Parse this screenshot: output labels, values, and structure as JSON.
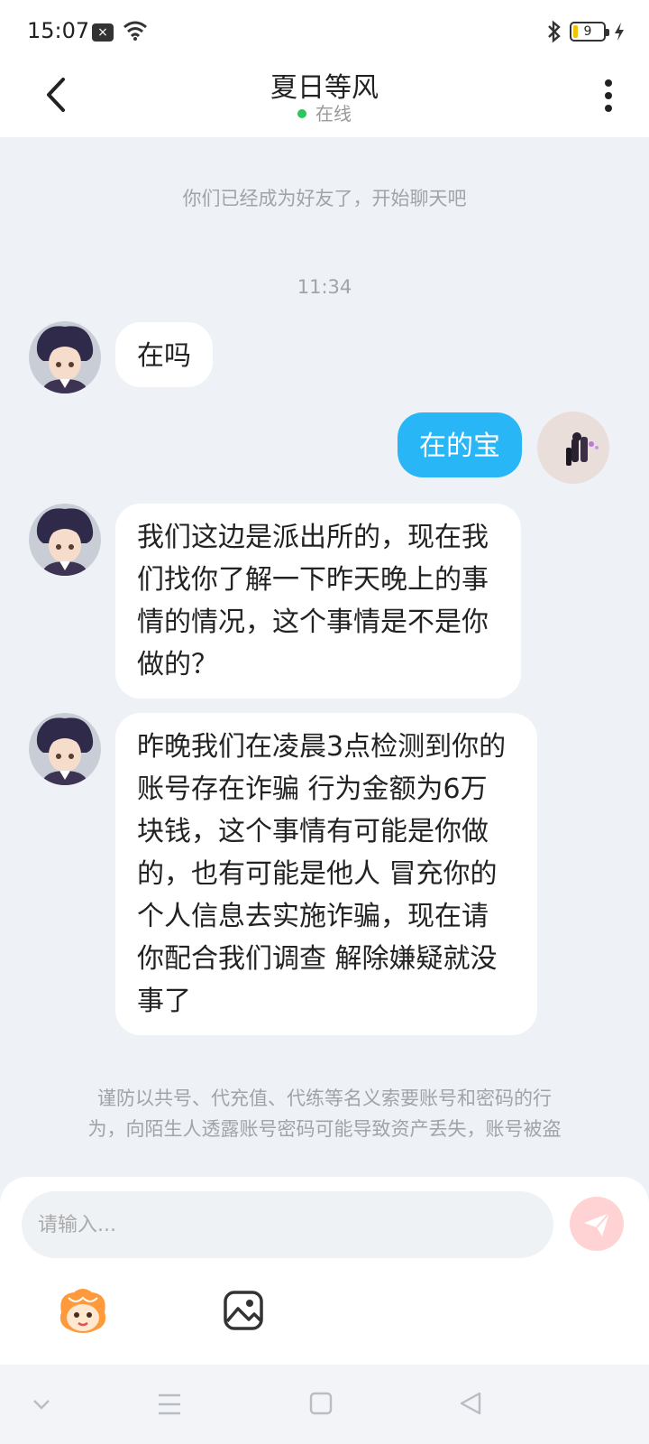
{
  "status_bar": {
    "time": "15:07",
    "battery": "9"
  },
  "header": {
    "title": "夏日等风",
    "status": "在线"
  },
  "chat": {
    "system_notice": "你们已经成为好友了，开始聊天吧",
    "timestamp": "11:34",
    "messages": [
      {
        "side": "left",
        "text": "在吗"
      },
      {
        "side": "right",
        "text": "在的宝"
      },
      {
        "side": "left",
        "lines": [
          "我们这边是派出所的，现在我",
          "们找你了解一下昨天晚上的事",
          "情的情况，这个事情是不是你",
          "做的？"
        ]
      },
      {
        "side": "left",
        "lines": [
          "昨晚我们在凌晨3点检测到你的",
          "账号存在诈骗  行为金额为6万",
          "块钱，这个事情有可能是你做",
          "的，也有可能是他人 冒充你的",
          "个人信息去实施诈骗，现在请",
          "你配合我们调查 解除嫌疑就没",
          "事了"
        ]
      }
    ],
    "warning": [
      "谨防以共号、代充值、代练等名义索要账号和密码的行",
      "为，向陌生人透露账号密码可能导致资产丢失，账号被盗"
    ]
  },
  "input": {
    "placeholder": "请输入..."
  },
  "colors": {
    "accent_bubble": "#29b6f6",
    "online": "#2fc55e",
    "send_disabled": "#ffd3d3"
  },
  "icons": {
    "back": "chevron-left-icon",
    "more": "vertical-dots-icon",
    "send": "paper-plane-icon",
    "emoji": "mascot-emoji-icon",
    "image": "image-icon"
  }
}
